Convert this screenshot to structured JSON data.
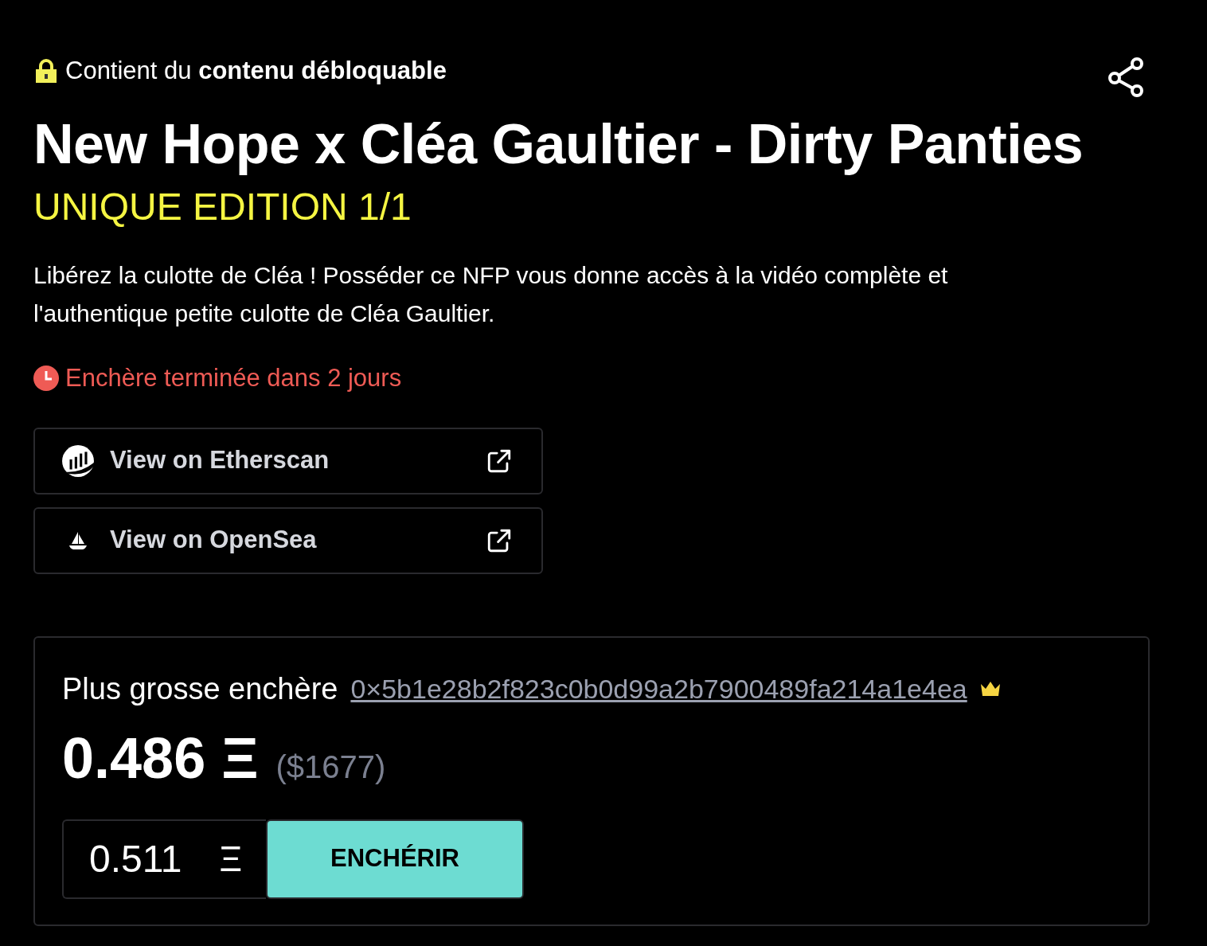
{
  "unlockable_notice": "Contient du **contenu débloquable**",
  "title": "New Hope x Cléa Gaultier - Dirty Panties",
  "edition": "UNIQUE EDITION 1/1",
  "description": "Libérez la culotte de Cléa ! Posséder ce NFP vous donne accès à la vidéo complète et l'authentique petite culotte de Cléa Gaultier.",
  "auction_timer": "Enchère terminée dans 2 jours",
  "links": [
    {
      "kind": "etherscan",
      "label": "View on Etherscan"
    },
    {
      "kind": "opensea",
      "label": "View on OpenSea"
    }
  ],
  "bid": {
    "label": "Plus grosse enchère",
    "bidder": "0×5b1e28b2f823c0b0d99a2b7900489fa214a1e4ea",
    "amount": "0.486 Ξ",
    "fiat": "($1677)",
    "input_value": "0.511",
    "currency": "Ξ",
    "button": "ENCHÉRIR"
  }
}
